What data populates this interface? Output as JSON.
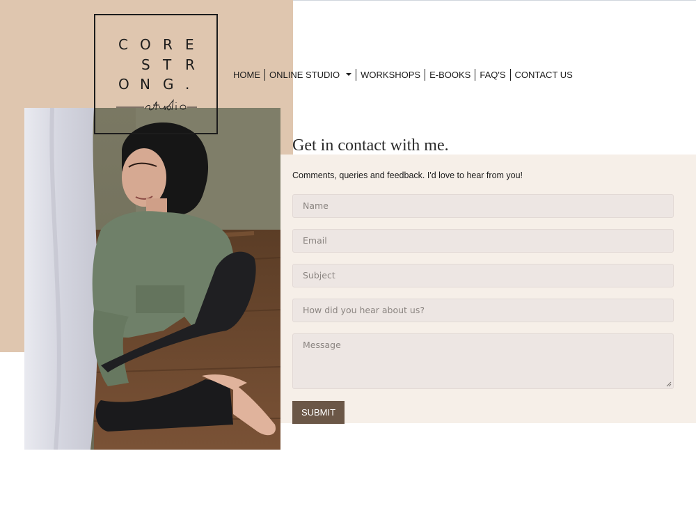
{
  "logo": {
    "row1": [
      "C",
      "O",
      "R",
      "E"
    ],
    "row2": [
      "S",
      "T",
      "R"
    ],
    "row3": [
      "O",
      "N",
      "G",
      "."
    ],
    "script": "studio"
  },
  "nav": {
    "items": [
      {
        "label": "HOME"
      },
      {
        "label": "ONLINE STUDIO",
        "has_dropdown": true
      },
      {
        "label": "WORKSHOPS"
      },
      {
        "label": "E-BOOKS"
      },
      {
        "label": "FAQ'S"
      },
      {
        "label": "CONTACT US"
      }
    ]
  },
  "contact": {
    "title": "Get in contact with me.",
    "subtitle": "Comments, queries and feedback. I'd love to hear from you!",
    "fields": {
      "name_placeholder": "Name",
      "email_placeholder": "Email",
      "subject_placeholder": "Subject",
      "source_placeholder": "How did you hear about us?",
      "message_placeholder": "Message"
    },
    "submit_label": "SUBMIT"
  },
  "colors": {
    "tan_background": "#dfc6af",
    "cream_panel": "#f6efe8",
    "field_background": "#ede6e3",
    "submit_button": "#6b5747"
  }
}
